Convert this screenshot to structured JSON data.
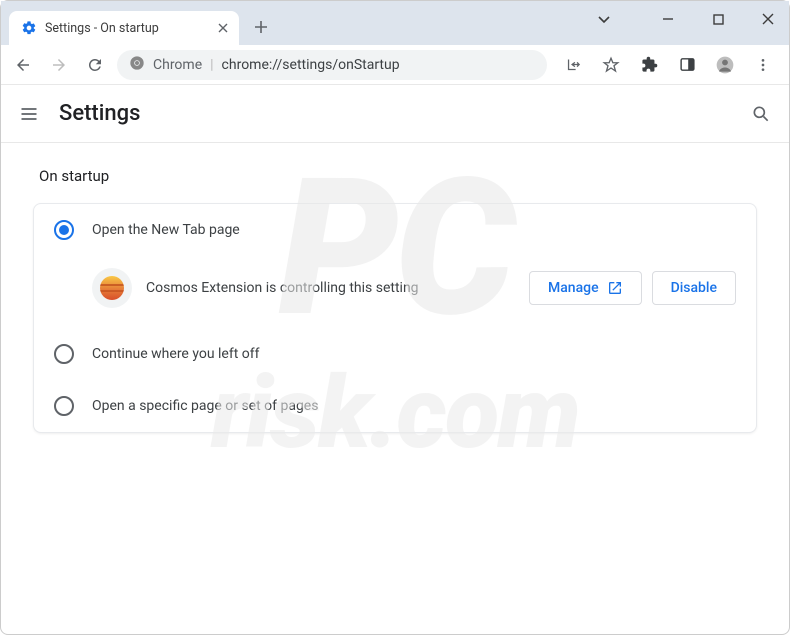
{
  "window": {
    "tab_title": "Settings - On startup"
  },
  "omnibox": {
    "scheme_label": "Chrome",
    "path": "chrome://settings/onStartup"
  },
  "app": {
    "title": "Settings"
  },
  "section": {
    "title": "On startup"
  },
  "options": {
    "open_new_tab": "Open the New Tab page",
    "continue": "Continue where you left off",
    "specific": "Open a specific page or set of pages"
  },
  "extension_notice": {
    "name": "Cosmos Extension",
    "message": "Cosmos Extension is controlling this setting",
    "manage_label": "Manage",
    "disable_label": "Disable"
  },
  "watermark": {
    "line1": "PC",
    "line2": "risk.com"
  }
}
